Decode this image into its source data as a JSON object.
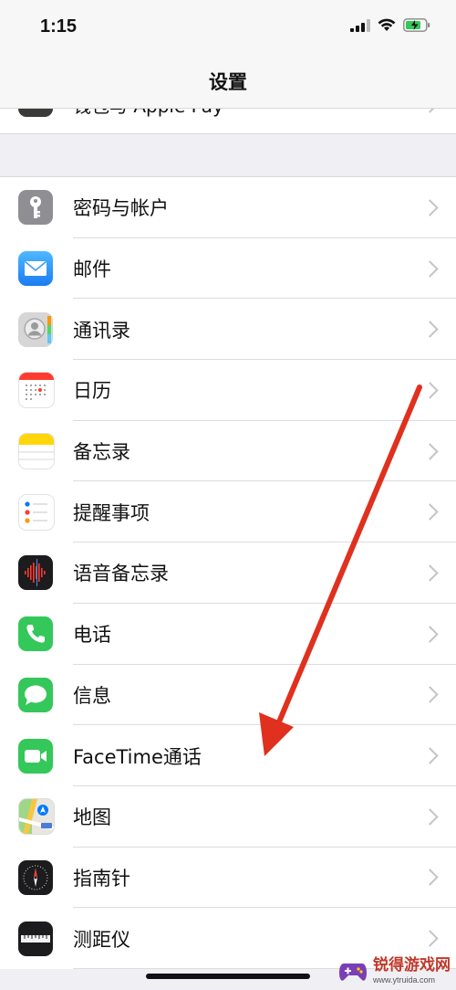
{
  "status": {
    "time": "1:15"
  },
  "nav": {
    "title": "设置"
  },
  "partial_item": {
    "label": "钱包与 Apple Pay"
  },
  "items": [
    {
      "label": "密码与帐户",
      "icon": "key-icon"
    },
    {
      "label": "邮件",
      "icon": "mail-icon"
    },
    {
      "label": "通讯录",
      "icon": "contacts-icon"
    },
    {
      "label": "日历",
      "icon": "calendar-icon"
    },
    {
      "label": "备忘录",
      "icon": "notes-icon"
    },
    {
      "label": "提醒事项",
      "icon": "reminders-icon"
    },
    {
      "label": "语音备忘录",
      "icon": "voice-memos-icon"
    },
    {
      "label": "电话",
      "icon": "phone-icon"
    },
    {
      "label": "信息",
      "icon": "messages-icon"
    },
    {
      "label": "FaceTime通话",
      "icon": "facetime-icon"
    },
    {
      "label": "地图",
      "icon": "maps-icon"
    },
    {
      "label": "指南针",
      "icon": "compass-icon"
    },
    {
      "label": "测距仪",
      "icon": "measure-icon"
    }
  ],
  "watermark": {
    "title": "锐得游戏网",
    "url": "www.ytruida.com"
  },
  "colors": {
    "annotation_arrow": "#e0301e",
    "accent_green": "#34c759"
  }
}
